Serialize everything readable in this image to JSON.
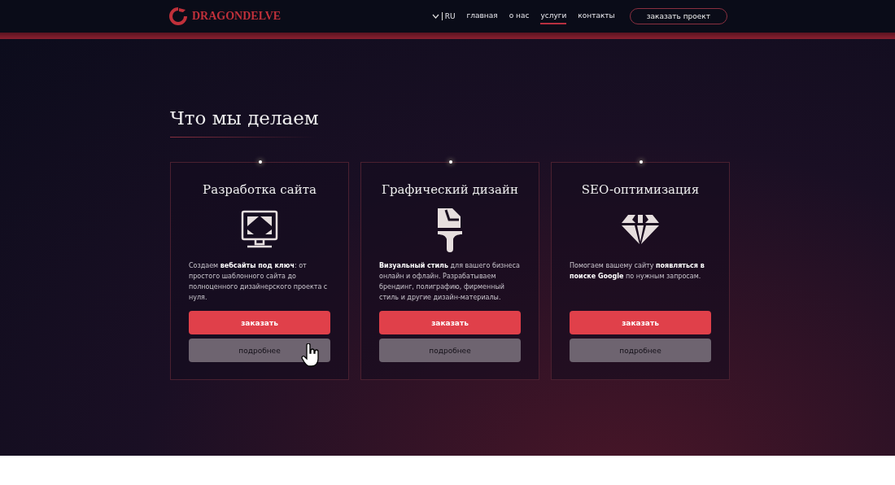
{
  "header": {
    "logo": "DRAGONDELVE",
    "language": "RU",
    "nav": [
      {
        "label": "главная",
        "selected": false
      },
      {
        "label": "о нас",
        "selected": false
      },
      {
        "label": "услуги",
        "selected": true
      },
      {
        "label": "контакты",
        "selected": false
      }
    ],
    "cta": "заказать проект"
  },
  "section": {
    "title": "Что мы делаем",
    "services": [
      {
        "kind": "monitor",
        "title": "Разработка сайта",
        "text": "Создаем **вебсайты под ключ**: от простого шаблонного сайта до полноценного дизайнерского проекта с нуля.",
        "order": "заказать",
        "more": "подробнее",
        "hovered": true
      },
      {
        "kind": "brush",
        "title": "Графический дизайн",
        "text": "**Визуальный стиль** для вашего бизнеса онлайн и офлайн. Разрабатываем брендинг, полиграфию, фирменный стиль и другие дизайн-материалы.",
        "order": "заказать",
        "more": "подробнее",
        "hovered": false
      },
      {
        "kind": "diamond",
        "title": "SEO-оптимизация",
        "text": "Помогаем вашему сайту **появляться в поиске Google** по нужным запросам.",
        "order": "заказать",
        "more": "подробнее",
        "hovered": false
      }
    ]
  }
}
